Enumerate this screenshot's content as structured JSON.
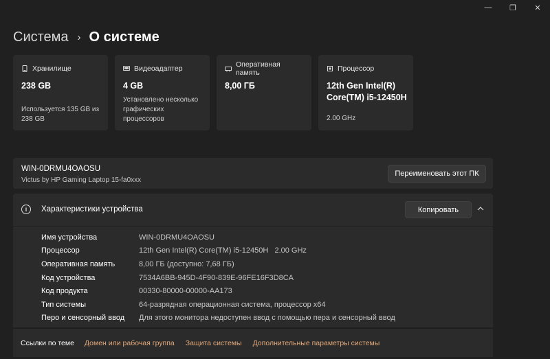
{
  "window": {
    "minimize_icon": "—",
    "maximize_icon": "❐",
    "close_icon": "✕"
  },
  "breadcrumb": {
    "parent": "Система",
    "separator": "›",
    "current": "О системе"
  },
  "cards": [
    {
      "icon": "storage-icon",
      "label": "Хранилище",
      "value": "238 GB",
      "note": "Используется 135 GB из 238 GB"
    },
    {
      "icon": "display-adapter-icon",
      "label": "Видеоадаптер",
      "value": "4 GB",
      "note": "Установлено несколько графических процессоров"
    },
    {
      "icon": "memory-icon",
      "label": "Оперативная память",
      "value": "8,00 ГБ",
      "note": ""
    },
    {
      "icon": "processor-icon",
      "label": "Процессор",
      "value": "12th Gen Intel(R) Core(TM) i5-12450H",
      "note": "2.00 GHz"
    }
  ],
  "device": {
    "name": "WIN-0DRMU4OAOSU",
    "model": "Victus by HP Gaming Laptop 15-fa0xxx",
    "rename_button": "Переименовать этот ПК"
  },
  "specs": {
    "title": "Характеристики устройства",
    "info_icon": "i",
    "copy_button": "Копировать",
    "collapse_icon": "^",
    "rows": [
      {
        "key": "Имя устройства",
        "value": "WIN-0DRMU4OAOSU"
      },
      {
        "key": "Процессор",
        "value": "12th Gen Intel(R) Core(TM) i5-12450H   2.00 GHz"
      },
      {
        "key": "Оперативная память",
        "value": "8,00 ГБ (доступно: 7,68 ГБ)"
      },
      {
        "key": "Код устройства",
        "value": "7534A6BB-945D-4F90-839E-96FE16F3D8CA"
      },
      {
        "key": "Код продукта",
        "value": "00330-80000-00000-AA173"
      },
      {
        "key": "Тип системы",
        "value": "64-разрядная операционная система, процессор x64"
      },
      {
        "key": "Перо и сенсорный ввод",
        "value": "Для этого монитора недоступен ввод с помощью пера и сенсорный ввод"
      }
    ]
  },
  "related": {
    "label": "Ссылки по теме",
    "links": [
      "Домен или рабочая группа",
      "Защита системы",
      "Дополнительные параметры системы"
    ]
  },
  "colors": {
    "background": "#202020",
    "panel": "#2b2b2b",
    "accent_link": "#e3a97a"
  }
}
